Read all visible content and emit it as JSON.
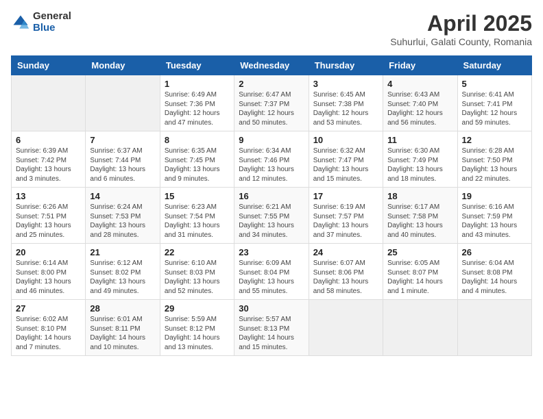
{
  "logo": {
    "general": "General",
    "blue": "Blue"
  },
  "title": "April 2025",
  "subtitle": "Suhurlui, Galati County, Romania",
  "days_header": [
    "Sunday",
    "Monday",
    "Tuesday",
    "Wednesday",
    "Thursday",
    "Friday",
    "Saturday"
  ],
  "weeks": [
    [
      {
        "day": "",
        "detail": ""
      },
      {
        "day": "",
        "detail": ""
      },
      {
        "day": "1",
        "detail": "Sunrise: 6:49 AM\nSunset: 7:36 PM\nDaylight: 12 hours\nand 47 minutes."
      },
      {
        "day": "2",
        "detail": "Sunrise: 6:47 AM\nSunset: 7:37 PM\nDaylight: 12 hours\nand 50 minutes."
      },
      {
        "day": "3",
        "detail": "Sunrise: 6:45 AM\nSunset: 7:38 PM\nDaylight: 12 hours\nand 53 minutes."
      },
      {
        "day": "4",
        "detail": "Sunrise: 6:43 AM\nSunset: 7:40 PM\nDaylight: 12 hours\nand 56 minutes."
      },
      {
        "day": "5",
        "detail": "Sunrise: 6:41 AM\nSunset: 7:41 PM\nDaylight: 12 hours\nand 59 minutes."
      }
    ],
    [
      {
        "day": "6",
        "detail": "Sunrise: 6:39 AM\nSunset: 7:42 PM\nDaylight: 13 hours\nand 3 minutes."
      },
      {
        "day": "7",
        "detail": "Sunrise: 6:37 AM\nSunset: 7:44 PM\nDaylight: 13 hours\nand 6 minutes."
      },
      {
        "day": "8",
        "detail": "Sunrise: 6:35 AM\nSunset: 7:45 PM\nDaylight: 13 hours\nand 9 minutes."
      },
      {
        "day": "9",
        "detail": "Sunrise: 6:34 AM\nSunset: 7:46 PM\nDaylight: 13 hours\nand 12 minutes."
      },
      {
        "day": "10",
        "detail": "Sunrise: 6:32 AM\nSunset: 7:47 PM\nDaylight: 13 hours\nand 15 minutes."
      },
      {
        "day": "11",
        "detail": "Sunrise: 6:30 AM\nSunset: 7:49 PM\nDaylight: 13 hours\nand 18 minutes."
      },
      {
        "day": "12",
        "detail": "Sunrise: 6:28 AM\nSunset: 7:50 PM\nDaylight: 13 hours\nand 22 minutes."
      }
    ],
    [
      {
        "day": "13",
        "detail": "Sunrise: 6:26 AM\nSunset: 7:51 PM\nDaylight: 13 hours\nand 25 minutes."
      },
      {
        "day": "14",
        "detail": "Sunrise: 6:24 AM\nSunset: 7:53 PM\nDaylight: 13 hours\nand 28 minutes."
      },
      {
        "day": "15",
        "detail": "Sunrise: 6:23 AM\nSunset: 7:54 PM\nDaylight: 13 hours\nand 31 minutes."
      },
      {
        "day": "16",
        "detail": "Sunrise: 6:21 AM\nSunset: 7:55 PM\nDaylight: 13 hours\nand 34 minutes."
      },
      {
        "day": "17",
        "detail": "Sunrise: 6:19 AM\nSunset: 7:57 PM\nDaylight: 13 hours\nand 37 minutes."
      },
      {
        "day": "18",
        "detail": "Sunrise: 6:17 AM\nSunset: 7:58 PM\nDaylight: 13 hours\nand 40 minutes."
      },
      {
        "day": "19",
        "detail": "Sunrise: 6:16 AM\nSunset: 7:59 PM\nDaylight: 13 hours\nand 43 minutes."
      }
    ],
    [
      {
        "day": "20",
        "detail": "Sunrise: 6:14 AM\nSunset: 8:00 PM\nDaylight: 13 hours\nand 46 minutes."
      },
      {
        "day": "21",
        "detail": "Sunrise: 6:12 AM\nSunset: 8:02 PM\nDaylight: 13 hours\nand 49 minutes."
      },
      {
        "day": "22",
        "detail": "Sunrise: 6:10 AM\nSunset: 8:03 PM\nDaylight: 13 hours\nand 52 minutes."
      },
      {
        "day": "23",
        "detail": "Sunrise: 6:09 AM\nSunset: 8:04 PM\nDaylight: 13 hours\nand 55 minutes."
      },
      {
        "day": "24",
        "detail": "Sunrise: 6:07 AM\nSunset: 8:06 PM\nDaylight: 13 hours\nand 58 minutes."
      },
      {
        "day": "25",
        "detail": "Sunrise: 6:05 AM\nSunset: 8:07 PM\nDaylight: 14 hours\nand 1 minute."
      },
      {
        "day": "26",
        "detail": "Sunrise: 6:04 AM\nSunset: 8:08 PM\nDaylight: 14 hours\nand 4 minutes."
      }
    ],
    [
      {
        "day": "27",
        "detail": "Sunrise: 6:02 AM\nSunset: 8:10 PM\nDaylight: 14 hours\nand 7 minutes."
      },
      {
        "day": "28",
        "detail": "Sunrise: 6:01 AM\nSunset: 8:11 PM\nDaylight: 14 hours\nand 10 minutes."
      },
      {
        "day": "29",
        "detail": "Sunrise: 5:59 AM\nSunset: 8:12 PM\nDaylight: 14 hours\nand 13 minutes."
      },
      {
        "day": "30",
        "detail": "Sunrise: 5:57 AM\nSunset: 8:13 PM\nDaylight: 14 hours\nand 15 minutes."
      },
      {
        "day": "",
        "detail": ""
      },
      {
        "day": "",
        "detail": ""
      },
      {
        "day": "",
        "detail": ""
      }
    ]
  ]
}
